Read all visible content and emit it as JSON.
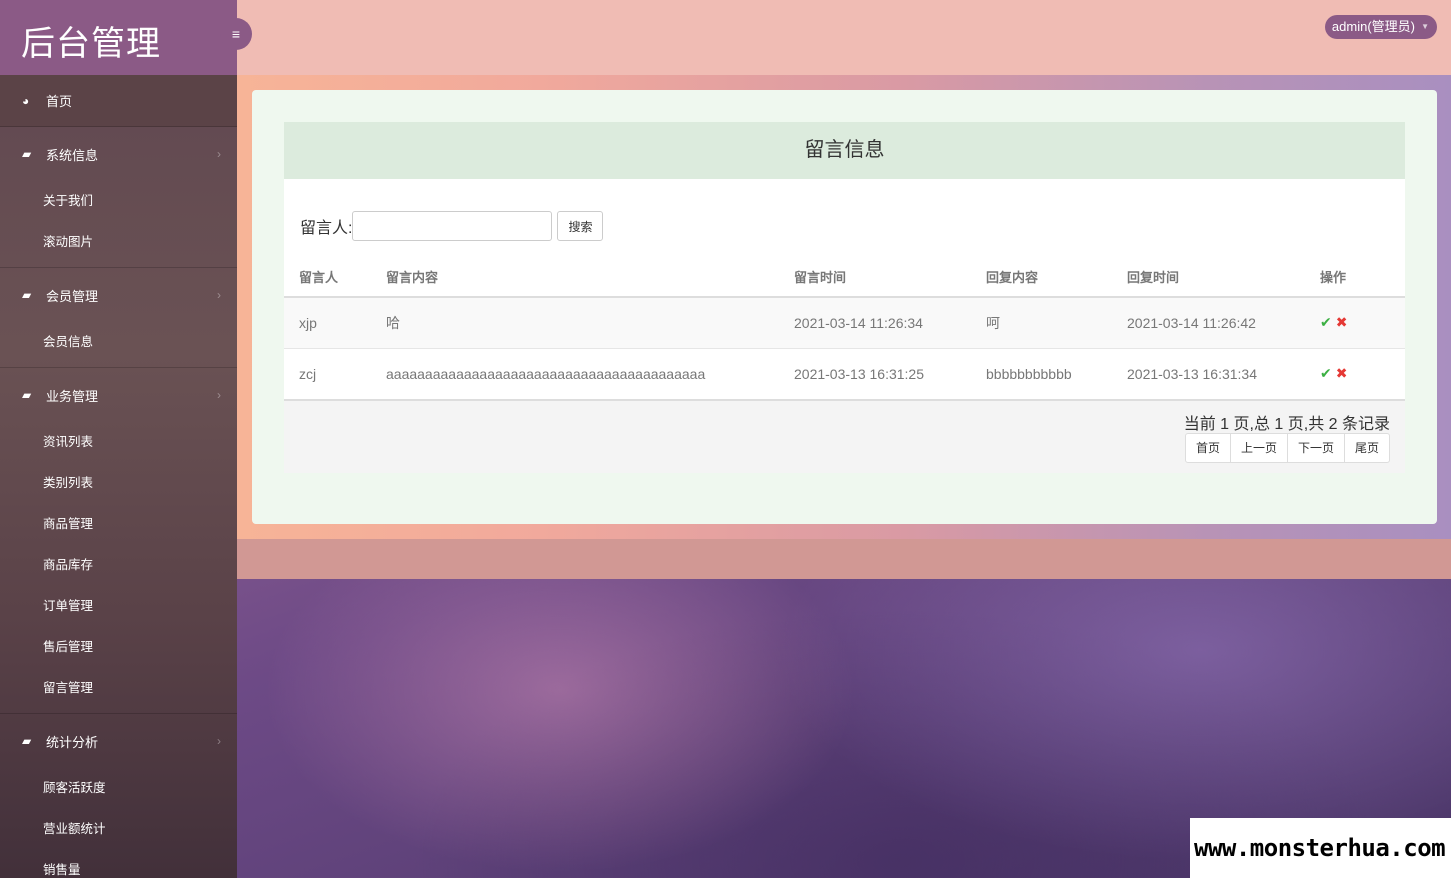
{
  "app": {
    "title": "后台管理"
  },
  "header": {
    "user": "admin(管理员)"
  },
  "sidebar": {
    "home": "首页",
    "groups": [
      {
        "label": "系统信息",
        "items": [
          "关于我们",
          "滚动图片"
        ]
      },
      {
        "label": "会员管理",
        "items": [
          "会员信息"
        ]
      },
      {
        "label": "业务管理",
        "items": [
          "资讯列表",
          "类别列表",
          "商品管理",
          "商品库存",
          "订单管理",
          "售后管理",
          "留言管理"
        ]
      },
      {
        "label": "统计分析",
        "items": [
          "顾客活跃度",
          "营业额统计",
          "销售量"
        ]
      }
    ]
  },
  "main": {
    "title": "留言信息",
    "search": {
      "label": "留言人:",
      "value": "",
      "placeholder": "",
      "button": "搜索"
    },
    "columns": [
      "留言人",
      "留言内容",
      "留言时间",
      "回复内容",
      "回复时间",
      "操作"
    ],
    "rows": [
      {
        "user": "xjp",
        "content": "哈",
        "time": "2021-03-14 11:26:34",
        "reply": "呵",
        "reply_time": "2021-03-14 11:26:42"
      },
      {
        "user": "zcj",
        "content": "aaaaaaaaaaaaaaaaaaaaaaaaaaaaaaaaaaaaaaaaa",
        "time": "2021-03-13 16:31:25",
        "reply": "bbbbbbbbbbb",
        "reply_time": "2021-03-13 16:31:34"
      }
    ],
    "pager": {
      "info": "当前 1 页,总 1 页,共 2 条记录",
      "first": "首页",
      "prev": "上一页",
      "next": "下一页",
      "last": "尾页"
    }
  },
  "watermark": "www.monsterhua.com",
  "colors": {
    "sidebar_logo": "#8b5a86",
    "header": "#f0bcb4",
    "panel": "#eff8ef",
    "title_bar": "#dcebdd"
  }
}
